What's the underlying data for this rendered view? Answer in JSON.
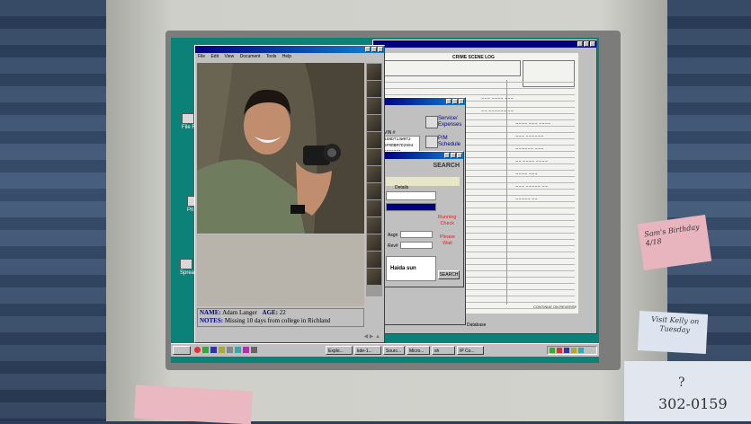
{
  "viewer": {
    "menu": [
      "File",
      "Edit",
      "View",
      "Document",
      "Tools",
      "Help"
    ],
    "name_label": "NAME:",
    "name_value": "Adam Langer",
    "age_label": "AGE:",
    "age_value": "22",
    "notes_label": "NOTES:",
    "notes_value": "Missing 10 days from college in Richland"
  },
  "crime_log": {
    "title": "CRIME SCENE LOG",
    "footer": "CONTINUE ON REVERSE",
    "window_label": "Database"
  },
  "vin_panel": {
    "label": "VIN #",
    "vin_line1": "1GNDT13W9T2",
    "vin_line2": "SFRRBM7D2904",
    "vin_line3": "5666691",
    "service_line1": "Service/",
    "service_line2": "Expenses",
    "pm_line1": "P/M",
    "pm_line2": "Schedule"
  },
  "search_window": {
    "title": "SEARCH",
    "tab": "Details",
    "status_line1": "Running",
    "status_line2": "Check",
    "wait_line1": "Please",
    "wait_line2": "Wait",
    "assign_label": "Asgn",
    "rev_label": "Rev#",
    "query_value": "Haida sun",
    "search_button": "SEARCH"
  },
  "desktop_icons": [
    "File R",
    "Pri",
    "Spread"
  ],
  "taskbar": {
    "items": [
      "Explo...",
      "kde-1...",
      "Sourc...",
      "Micro...",
      "sh",
      "IP Co..."
    ]
  },
  "sticky_notes": {
    "birthday": "Sam's Birthday 4/18",
    "kelly": "Visit Kelly on Tuesday",
    "phone": "302-0159",
    "question": "?"
  },
  "colors": {
    "desktop": "#0c8177",
    "title_bar": "#000080",
    "window_face": "#c0c0c0",
    "alert_red": "#e02020",
    "sticky_pink": "#e8b4bd",
    "sticky_blue": "#dde4f0"
  }
}
